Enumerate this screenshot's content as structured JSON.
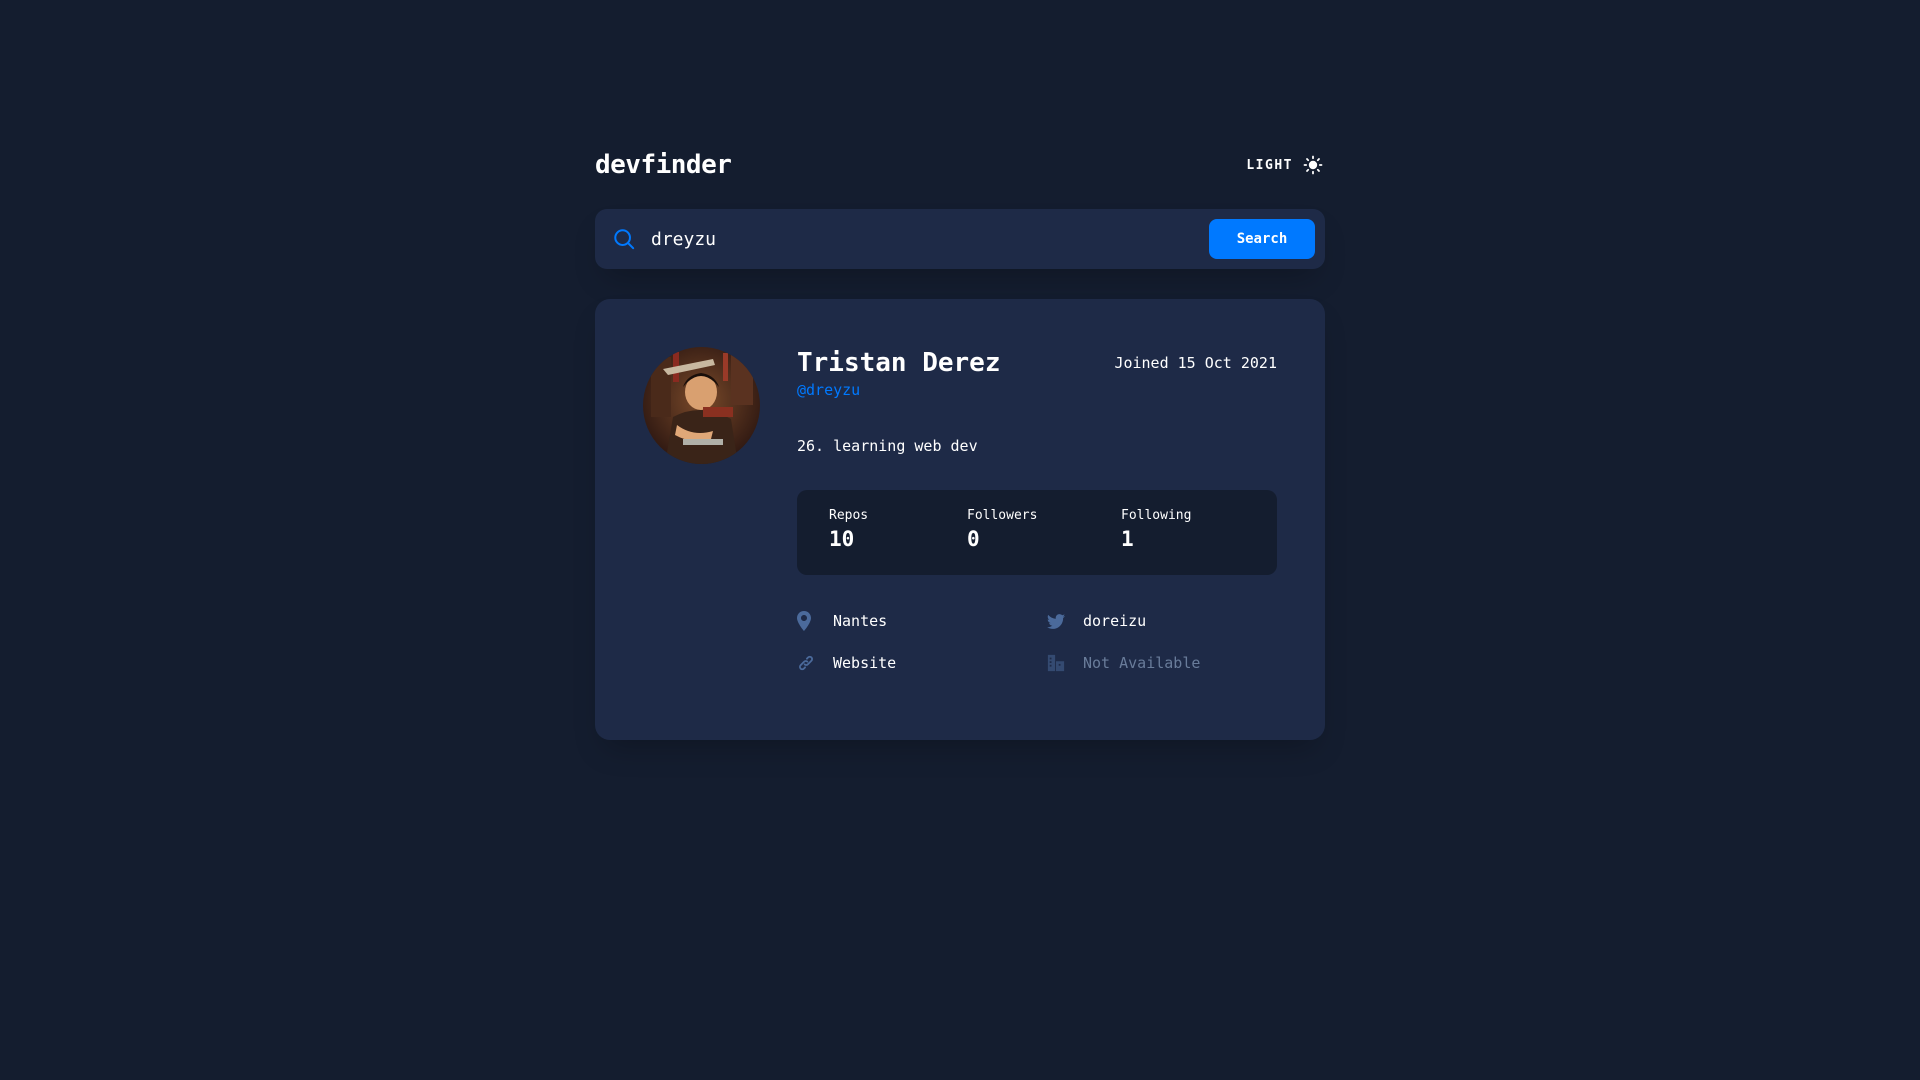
{
  "header": {
    "logo": "devfinder",
    "theme_label": "LIGHT",
    "theme_icon": "sun-icon"
  },
  "search": {
    "value": "dreyzu",
    "placeholder": "dreyzu",
    "button_label": "Search",
    "icon": "search-icon"
  },
  "profile": {
    "name": "Tristan Derez",
    "login": "@dreyzu",
    "joined": "Joined 15 Oct 2021",
    "bio": "26. learning web dev",
    "stats": [
      {
        "label": "Repos",
        "value": "10"
      },
      {
        "label": "Followers",
        "value": "0"
      },
      {
        "label": "Following",
        "value": "1"
      }
    ],
    "links": {
      "location": "Nantes",
      "twitter": "doreizu",
      "website": "Website",
      "company": "Not Available"
    }
  },
  "colors": {
    "background": "#141d2f",
    "card": "#1e2a47",
    "accent": "#0079ff",
    "muted": "#697c9a"
  }
}
